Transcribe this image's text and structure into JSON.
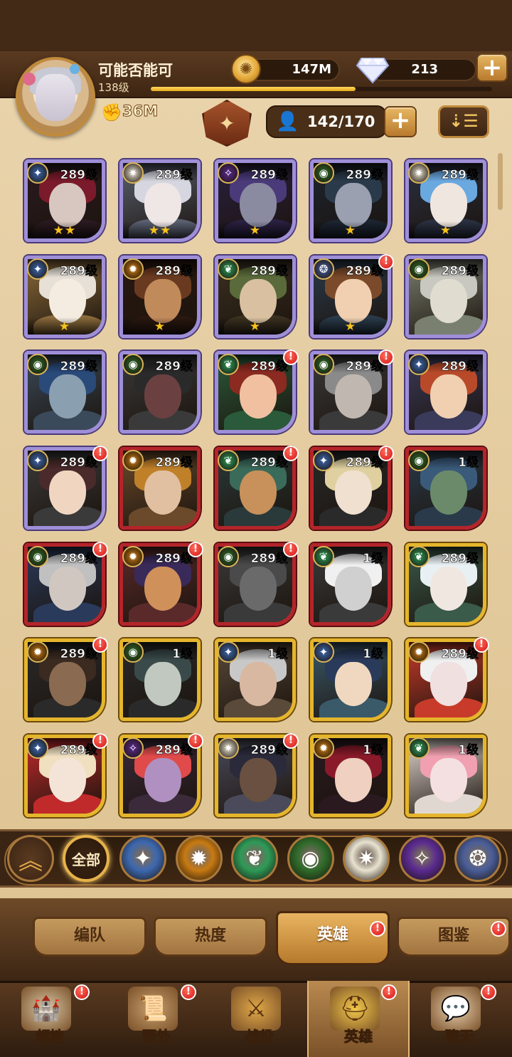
{
  "player": {
    "name": "可能否能可",
    "level": "138级",
    "power": "36M",
    "xp_fraction": 0.6
  },
  "resources": {
    "gold": "147M",
    "diamonds": "213"
  },
  "roster": {
    "count": "142/170"
  },
  "heroes": [
    {
      "level": "289级",
      "frame": "purple",
      "faction": "lightbearer",
      "stars": "★★",
      "alert": false
    },
    {
      "level": "289级",
      "frame": "purple",
      "faction": "celestial",
      "stars": "★★",
      "alert": false
    },
    {
      "level": "289级",
      "frame": "purple",
      "faction": "hypogean",
      "stars": "★",
      "alert": false
    },
    {
      "level": "289级",
      "frame": "purple",
      "faction": "graveborn",
      "stars": "★",
      "alert": false
    },
    {
      "level": "289级",
      "frame": "purple",
      "faction": "celestial",
      "stars": "★",
      "alert": false
    },
    {
      "level": "289级",
      "frame": "purple",
      "faction": "lightbearer",
      "stars": "★",
      "alert": false
    },
    {
      "level": "289级",
      "frame": "purple",
      "faction": "mauler",
      "stars": "★",
      "alert": false
    },
    {
      "level": "289级",
      "frame": "purple",
      "faction": "wilder",
      "stars": "★",
      "alert": false
    },
    {
      "level": "289级",
      "frame": "purple",
      "faction": "dimensional",
      "stars": "★",
      "alert": true
    },
    {
      "level": "289级",
      "frame": "purple",
      "faction": "graveborn",
      "stars": "",
      "alert": false
    },
    {
      "level": "289级",
      "frame": "purple",
      "faction": "graveborn",
      "stars": "",
      "alert": false
    },
    {
      "level": "289级",
      "frame": "purple",
      "faction": "graveborn",
      "stars": "",
      "alert": false
    },
    {
      "level": "289级",
      "frame": "purple",
      "faction": "wilder",
      "stars": "",
      "alert": true
    },
    {
      "level": "289级",
      "frame": "purple",
      "faction": "graveborn",
      "stars": "",
      "alert": true
    },
    {
      "level": "289级",
      "frame": "purple",
      "faction": "lightbearer",
      "stars": "",
      "alert": false
    },
    {
      "level": "289级",
      "frame": "purple",
      "faction": "lightbearer",
      "stars": "",
      "alert": true
    },
    {
      "level": "289级",
      "frame": "red",
      "faction": "mauler",
      "stars": "",
      "alert": false
    },
    {
      "level": "289级",
      "frame": "red",
      "faction": "wilder",
      "stars": "",
      "alert": true
    },
    {
      "level": "289级",
      "frame": "red",
      "faction": "lightbearer",
      "stars": "",
      "alert": true
    },
    {
      "level": "1级",
      "frame": "red",
      "faction": "graveborn",
      "stars": "",
      "alert": false
    },
    {
      "level": "289级",
      "frame": "red",
      "faction": "graveborn",
      "stars": "",
      "alert": true
    },
    {
      "level": "289级",
      "frame": "red",
      "faction": "mauler",
      "stars": "",
      "alert": true
    },
    {
      "level": "289级",
      "frame": "red",
      "faction": "graveborn",
      "stars": "",
      "alert": true
    },
    {
      "level": "1级",
      "frame": "red",
      "faction": "wilder",
      "stars": "",
      "alert": false
    },
    {
      "level": "289级",
      "frame": "gold",
      "faction": "wilder",
      "stars": "",
      "alert": false
    },
    {
      "level": "289级",
      "frame": "gold",
      "faction": "mauler",
      "stars": "",
      "alert": true
    },
    {
      "level": "1级",
      "frame": "gold",
      "faction": "graveborn",
      "stars": "",
      "alert": false
    },
    {
      "level": "1级",
      "frame": "gold",
      "faction": "lightbearer",
      "stars": "",
      "alert": false
    },
    {
      "level": "1级",
      "frame": "gold",
      "faction": "lightbearer",
      "stars": "",
      "alert": false
    },
    {
      "level": "289级",
      "frame": "gold",
      "faction": "mauler",
      "stars": "",
      "alert": true
    },
    {
      "level": "289级",
      "frame": "gold",
      "faction": "lightbearer",
      "stars": "",
      "alert": true
    },
    {
      "level": "289级",
      "frame": "gold",
      "faction": "hypogean",
      "stars": "",
      "alert": true
    },
    {
      "level": "289级",
      "frame": "gold",
      "faction": "celestial",
      "stars": "",
      "alert": true
    },
    {
      "level": "1级",
      "frame": "gold",
      "faction": "mauler",
      "stars": "",
      "alert": false
    },
    {
      "level": "1级",
      "frame": "gold",
      "faction": "wilder",
      "stars": "",
      "alert": false
    }
  ],
  "filters": {
    "all_label": "全部",
    "factions": [
      "lightbearer",
      "mauler",
      "wilder",
      "graveborn",
      "celestial",
      "hypogean",
      "dimensional"
    ]
  },
  "subtabs": [
    {
      "label": "编队",
      "active": false,
      "alert": false
    },
    {
      "label": "热度",
      "active": false,
      "alert": false
    },
    {
      "label": "英雄",
      "active": true,
      "alert": true
    },
    {
      "label": "图鉴",
      "active": false,
      "alert": true
    }
  ],
  "nav": [
    {
      "label": "领地",
      "icon": "castle-icon",
      "alert": true
    },
    {
      "label": "野外",
      "icon": "scroll-map-icon",
      "alert": true
    },
    {
      "label": "战役",
      "icon": "sword-shield-icon",
      "alert": false
    },
    {
      "label": "英雄",
      "icon": "helmet-icon",
      "alert": true,
      "active": true
    },
    {
      "label": "聊天",
      "icon": "chat-bubble-icon",
      "alert": true
    }
  ],
  "colors": {
    "lightbearer": "#3c68b0",
    "mauler": "#c87a12",
    "wilder": "#2d9a57",
    "graveborn": "#2f6b2a",
    "celestial": "#e8e2d0",
    "hypogean": "#5a2a90",
    "dimensional": "#4a5e9a"
  }
}
